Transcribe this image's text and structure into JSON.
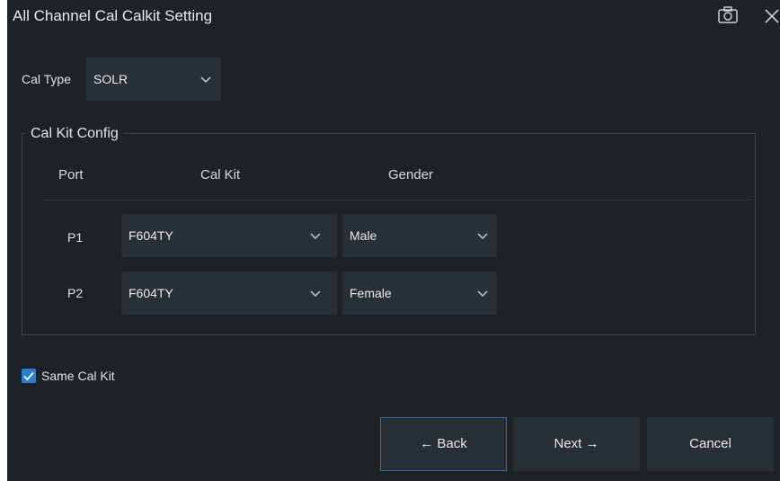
{
  "window": {
    "title": "All Channel Cal Calkit Setting",
    "icons": [
      "camera-icon",
      "close-icon"
    ]
  },
  "cal_type": {
    "label": "Cal Type",
    "value": "SOLR"
  },
  "cal_kit_config": {
    "legend": "Cal Kit Config",
    "headers": {
      "port": "Port",
      "cal_kit": "Cal Kit",
      "gender": "Gender"
    },
    "rows": [
      {
        "port": "P1",
        "cal_kit": "F604TY",
        "gender": "Male"
      },
      {
        "port": "P2",
        "cal_kit": "F604TY",
        "gender": "Female"
      }
    ]
  },
  "same_cal_kit": {
    "label": "Same Cal Kit",
    "checked": true
  },
  "buttons": {
    "back": "← Back",
    "next": "Next →",
    "cancel": "Cancel"
  },
  "colors": {
    "background": "#1d2227",
    "field": "#282f35",
    "accent": "#2a7fd4",
    "focus_border": "#2f6ea8"
  }
}
